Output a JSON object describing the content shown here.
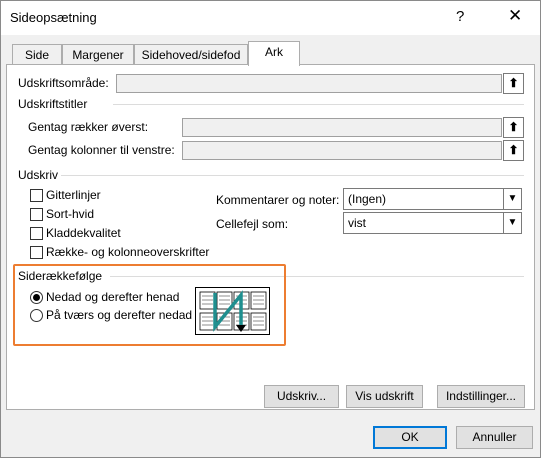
{
  "window": {
    "title": "Sideopsætning",
    "help": "?",
    "close": "✕"
  },
  "tabs": [
    {
      "label": "Side"
    },
    {
      "label": "Margener"
    },
    {
      "label": "Sidehoved/sidefod"
    },
    {
      "label": "Ark"
    }
  ],
  "print_area": {
    "label": "Udskriftsområde:",
    "value": ""
  },
  "print_titles": {
    "heading": "Udskriftstitler",
    "rows_label": "Gentag rækker øverst:",
    "cols_label": "Gentag kolonner til venstre:"
  },
  "print": {
    "heading": "Udskriv",
    "checkboxes": [
      {
        "label": "Gitterlinjer",
        "checked": false
      },
      {
        "label": "Sort-hvid",
        "checked": false
      },
      {
        "label": "Kladdekvalitet",
        "checked": false
      },
      {
        "label": "Række- og kolonneoverskrifter",
        "checked": false
      }
    ],
    "comments_label": "Kommentarer og noter:",
    "comments_value": "(Ingen)",
    "errors_label": "Cellefejl som:",
    "errors_value": "vist"
  },
  "page_order": {
    "heading": "Siderækkefølge",
    "options": [
      {
        "label": "Nedad og derefter henad",
        "selected": true
      },
      {
        "label": "På tværs og derefter nedad",
        "selected": false
      }
    ]
  },
  "buttons": {
    "print": "Udskriv...",
    "preview": "Vis udskrift",
    "options": "Indstillinger...",
    "ok": "OK",
    "cancel": "Annuller"
  },
  "icons": {
    "collapse": "up-arrow-icon",
    "dropdown": "chevron-down-icon"
  },
  "colors": {
    "highlight": "#ed7d31",
    "accent": "#0078d7",
    "arrow": "#1f8f8f"
  }
}
